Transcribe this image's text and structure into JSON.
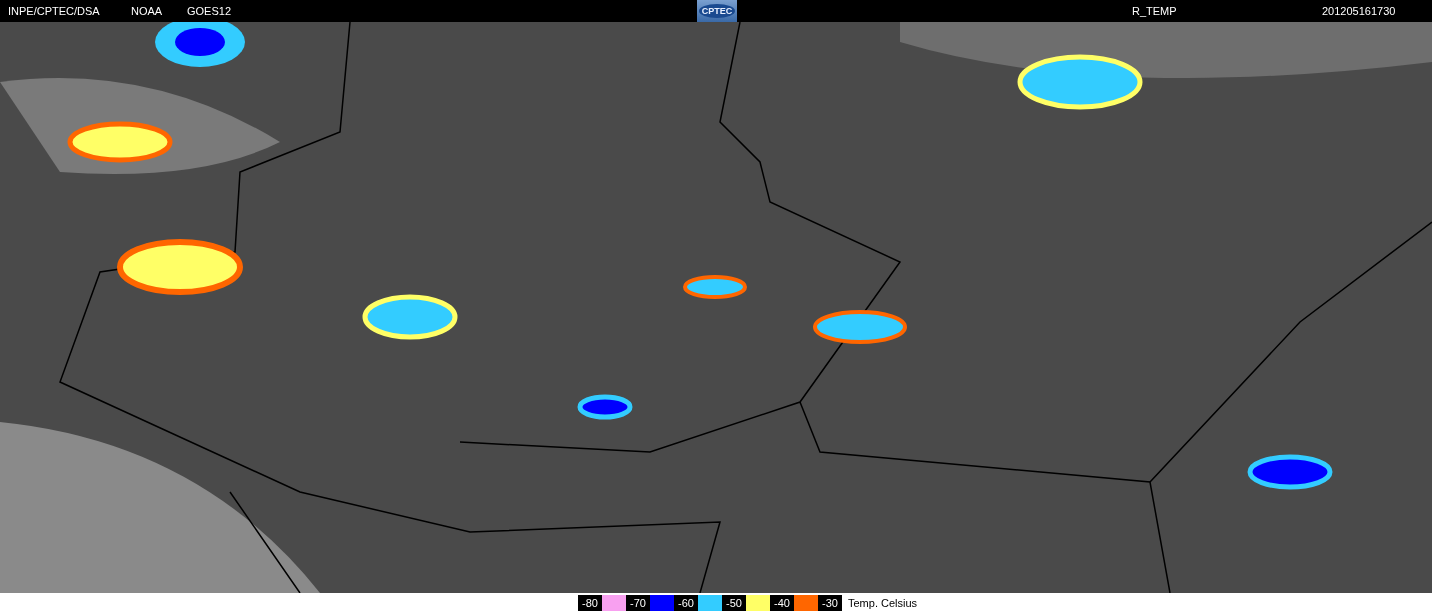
{
  "header": {
    "labels": [
      "INPE/CPTEC/DSA",
      "NOAA",
      "GOES12"
    ],
    "logo": "CPTEC",
    "product": "R_TEMP",
    "timestamp": "201205161730"
  },
  "legend": {
    "items": [
      {
        "label": "-80",
        "color": "#f8a0f0"
      },
      {
        "label": "-70",
        "color": "#0000ff"
      },
      {
        "label": "-60",
        "color": "#33ccff"
      },
      {
        "label": "-50",
        "color": "#ffff66"
      },
      {
        "label": "-40",
        "color": "#ff6600"
      },
      {
        "label": "-30"
      }
    ],
    "unit": "Temp. Celsius"
  }
}
